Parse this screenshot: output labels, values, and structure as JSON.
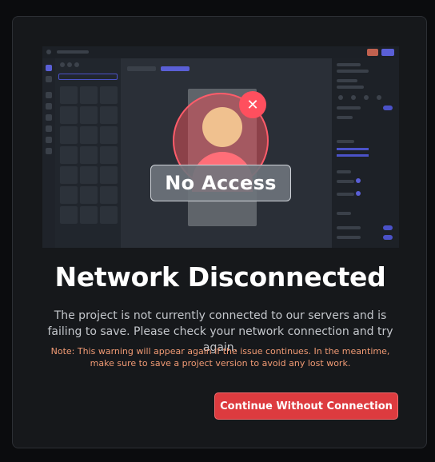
{
  "illustration": {
    "badge_text": "No Access",
    "close_glyph": "✕",
    "icons": [
      "user-avatar-icon",
      "close-icon"
    ]
  },
  "dialog": {
    "title": "Network Disconnected",
    "description": "The project is not currently connected to our servers and is failing to save. Please check your network connection and try again.",
    "note": "Note: This warning will appear again if the issue continues. In the meantime, make sure to save a project version to avoid any lost work.",
    "button_label": "Continue Without Connection"
  },
  "colors": {
    "accent_red": "#dd3b3f",
    "note_orange": "#f09a74",
    "background": "#16181b"
  }
}
